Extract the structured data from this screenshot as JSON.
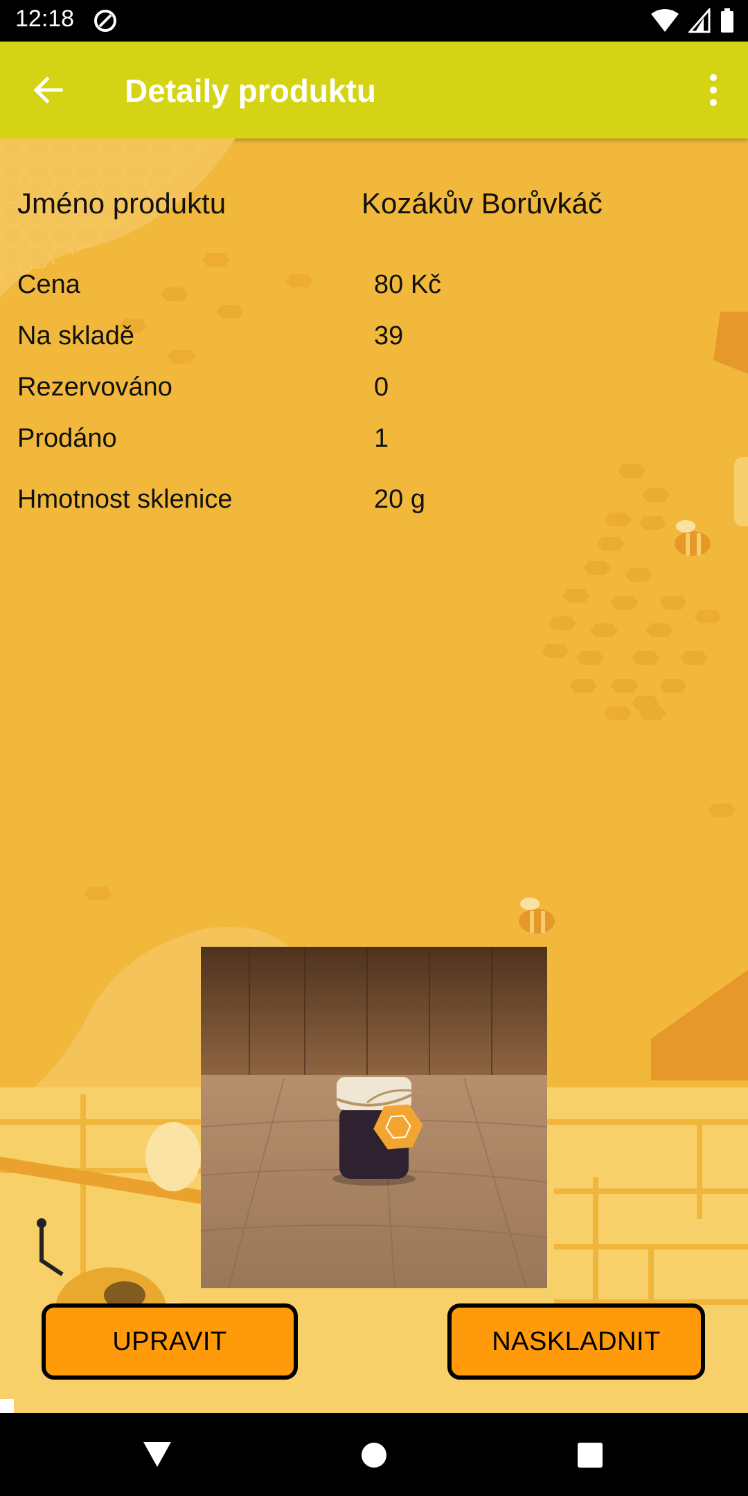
{
  "status_bar": {
    "time": "12:18",
    "left_icon": "at-sign-icon",
    "right_icons": [
      "wifi-icon",
      "signal-icon",
      "battery-icon"
    ]
  },
  "app_bar": {
    "title": "Detaily produktu",
    "back_icon": "arrow-left-icon",
    "menu_icon": "more-vertical-icon",
    "color": "#d4d414"
  },
  "product": {
    "name_label": "Jméno produktu",
    "name_value": "Kozákův Borůvkáč",
    "rows": [
      {
        "label": "Cena",
        "value": "80 Kč"
      },
      {
        "label": "Na skladě",
        "value": "39"
      },
      {
        "label": "Rezervováno",
        "value": "0"
      },
      {
        "label": "Prodáno",
        "value": "1"
      },
      {
        "label": "Hmotnost sklenice",
        "value": "20 g"
      }
    ]
  },
  "buttons": {
    "edit": "UPRAVIT",
    "restock": "NASKLADNIT",
    "color": "#ff9a0a"
  },
  "nav_bar": {
    "icons": [
      "nav-back-icon",
      "nav-home-icon",
      "nav-recents-icon"
    ]
  },
  "colors": {
    "background": "#f2b83c"
  }
}
